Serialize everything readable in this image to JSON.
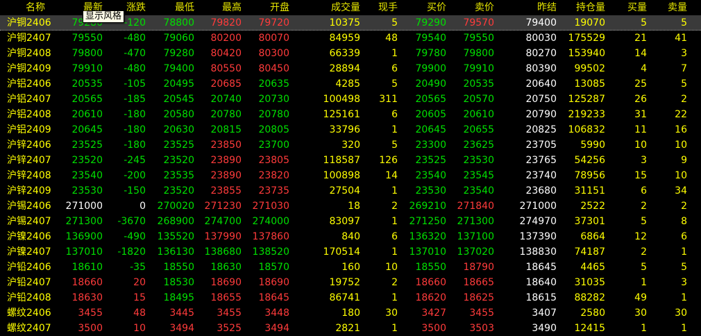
{
  "tooltip": "显示风格",
  "columns": [
    "名称",
    "最新",
    "涨跌",
    "最低",
    "最高",
    "开盘",
    "成交量",
    "现手",
    "买价",
    "卖价",
    "昨结",
    "持仓量",
    "买量",
    "卖量"
  ],
  "colors": {
    "up": "#ff3b3b",
    "down": "#00e000",
    "flat": "#ffffff",
    "header": "#e6e600",
    "volume": "#ffff00"
  },
  "selected_row": 0,
  "rows": [
    {
      "name": "沪铜2406",
      "last": "79280",
      "chg": "-120",
      "low": "78800",
      "high": "79820",
      "open": "79720",
      "vol": "10375",
      "cur": "5",
      "bid": "79290",
      "ask": "79570",
      "pre": "79400",
      "oi": "19070",
      "bq": "5",
      "aq": "5"
    },
    {
      "name": "沪铜2407",
      "last": "79550",
      "chg": "-480",
      "low": "79060",
      "high": "80200",
      "open": "80070",
      "vol": "84959",
      "cur": "48",
      "bid": "79540",
      "ask": "79550",
      "pre": "80030",
      "oi": "175529",
      "bq": "21",
      "aq": "41"
    },
    {
      "name": "沪铜2408",
      "last": "79800",
      "chg": "-470",
      "low": "79280",
      "high": "80420",
      "open": "80300",
      "vol": "66339",
      "cur": "1",
      "bid": "79780",
      "ask": "79800",
      "pre": "80270",
      "oi": "153940",
      "bq": "14",
      "aq": "3"
    },
    {
      "name": "沪铜2409",
      "last": "79910",
      "chg": "-480",
      "low": "79400",
      "high": "80550",
      "open": "80450",
      "vol": "28894",
      "cur": "6",
      "bid": "79900",
      "ask": "79910",
      "pre": "80390",
      "oi": "99502",
      "bq": "4",
      "aq": "7"
    },
    {
      "name": "沪铝2406",
      "last": "20535",
      "chg": "-105",
      "low": "20495",
      "high": "20685",
      "open": "20635",
      "vol": "4285",
      "cur": "5",
      "bid": "20490",
      "ask": "20535",
      "pre": "20640",
      "oi": "13085",
      "bq": "25",
      "aq": "5"
    },
    {
      "name": "沪铝2407",
      "last": "20565",
      "chg": "-185",
      "low": "20545",
      "high": "20740",
      "open": "20730",
      "vol": "100498",
      "cur": "311",
      "bid": "20565",
      "ask": "20570",
      "pre": "20750",
      "oi": "125287",
      "bq": "26",
      "aq": "2"
    },
    {
      "name": "沪铝2408",
      "last": "20610",
      "chg": "-180",
      "low": "20580",
      "high": "20780",
      "open": "20780",
      "vol": "125161",
      "cur": "6",
      "bid": "20605",
      "ask": "20610",
      "pre": "20790",
      "oi": "219233",
      "bq": "31",
      "aq": "22"
    },
    {
      "name": "沪铝2409",
      "last": "20645",
      "chg": "-180",
      "low": "20630",
      "high": "20815",
      "open": "20805",
      "vol": "33796",
      "cur": "1",
      "bid": "20645",
      "ask": "20655",
      "pre": "20825",
      "oi": "106832",
      "bq": "11",
      "aq": "16"
    },
    {
      "name": "沪锌2406",
      "last": "23525",
      "chg": "-180",
      "low": "23525",
      "high": "23850",
      "open": "23700",
      "vol": "320",
      "cur": "5",
      "bid": "23300",
      "ask": "23625",
      "pre": "23705",
      "oi": "5990",
      "bq": "10",
      "aq": "10"
    },
    {
      "name": "沪锌2407",
      "last": "23520",
      "chg": "-245",
      "low": "23520",
      "high": "23890",
      "open": "23805",
      "vol": "118587",
      "cur": "126",
      "bid": "23525",
      "ask": "23530",
      "pre": "23765",
      "oi": "54256",
      "bq": "3",
      "aq": "9"
    },
    {
      "name": "沪锌2408",
      "last": "23540",
      "chg": "-200",
      "low": "23535",
      "high": "23890",
      "open": "23820",
      "vol": "100898",
      "cur": "14",
      "bid": "23540",
      "ask": "23545",
      "pre": "23740",
      "oi": "78956",
      "bq": "15",
      "aq": "10"
    },
    {
      "name": "沪锌2409",
      "last": "23530",
      "chg": "-150",
      "low": "23520",
      "high": "23855",
      "open": "23735",
      "vol": "27504",
      "cur": "1",
      "bid": "23530",
      "ask": "23540",
      "pre": "23680",
      "oi": "31151",
      "bq": "6",
      "aq": "34"
    },
    {
      "name": "沪锡2406",
      "last": "271000",
      "chg": "0",
      "low": "270020",
      "high": "271230",
      "open": "271030",
      "vol": "18",
      "cur": "2",
      "bid": "269210",
      "ask": "271840",
      "pre": "271000",
      "oi": "2522",
      "bq": "2",
      "aq": "2"
    },
    {
      "name": "沪锡2407",
      "last": "271300",
      "chg": "-3670",
      "low": "268900",
      "high": "274700",
      "open": "274000",
      "vol": "83097",
      "cur": "1",
      "bid": "271250",
      "ask": "271300",
      "pre": "274970",
      "oi": "37301",
      "bq": "5",
      "aq": "8"
    },
    {
      "name": "沪镍2406",
      "last": "136900",
      "chg": "-490",
      "low": "135520",
      "high": "137990",
      "open": "137860",
      "vol": "840",
      "cur": "6",
      "bid": "136320",
      "ask": "137100",
      "pre": "137390",
      "oi": "6864",
      "bq": "12",
      "aq": "6"
    },
    {
      "name": "沪镍2407",
      "last": "137010",
      "chg": "-1820",
      "low": "136130",
      "high": "138680",
      "open": "138520",
      "vol": "170514",
      "cur": "1",
      "bid": "137010",
      "ask": "137020",
      "pre": "138830",
      "oi": "74187",
      "bq": "2",
      "aq": "1"
    },
    {
      "name": "沪铅2406",
      "last": "18610",
      "chg": "-35",
      "low": "18550",
      "high": "18630",
      "open": "18570",
      "vol": "160",
      "cur": "10",
      "bid": "18550",
      "ask": "18790",
      "pre": "18645",
      "oi": "4465",
      "bq": "5",
      "aq": "5"
    },
    {
      "name": "沪铅2407",
      "last": "18660",
      "chg": "20",
      "low": "18530",
      "high": "18690",
      "open": "18690",
      "vol": "19752",
      "cur": "2",
      "bid": "18660",
      "ask": "18665",
      "pre": "18640",
      "oi": "31035",
      "bq": "1",
      "aq": "3"
    },
    {
      "name": "沪铅2408",
      "last": "18630",
      "chg": "15",
      "low": "18495",
      "high": "18655",
      "open": "18645",
      "vol": "86741",
      "cur": "1",
      "bid": "18620",
      "ask": "18625",
      "pre": "18615",
      "oi": "88282",
      "bq": "49",
      "aq": "1"
    },
    {
      "name": "螺纹2406",
      "last": "3455",
      "chg": "48",
      "low": "3445",
      "high": "3455",
      "open": "3448",
      "vol": "180",
      "cur": "30",
      "bid": "3427",
      "ask": "3455",
      "pre": "3407",
      "oi": "2580",
      "bq": "30",
      "aq": "30"
    },
    {
      "name": "螺纹2407",
      "last": "3500",
      "chg": "10",
      "low": "3494",
      "high": "3525",
      "open": "3494",
      "vol": "2821",
      "cur": "1",
      "bid": "3500",
      "ask": "3503",
      "pre": "3490",
      "oi": "12415",
      "bq": "1",
      "aq": "1"
    }
  ]
}
